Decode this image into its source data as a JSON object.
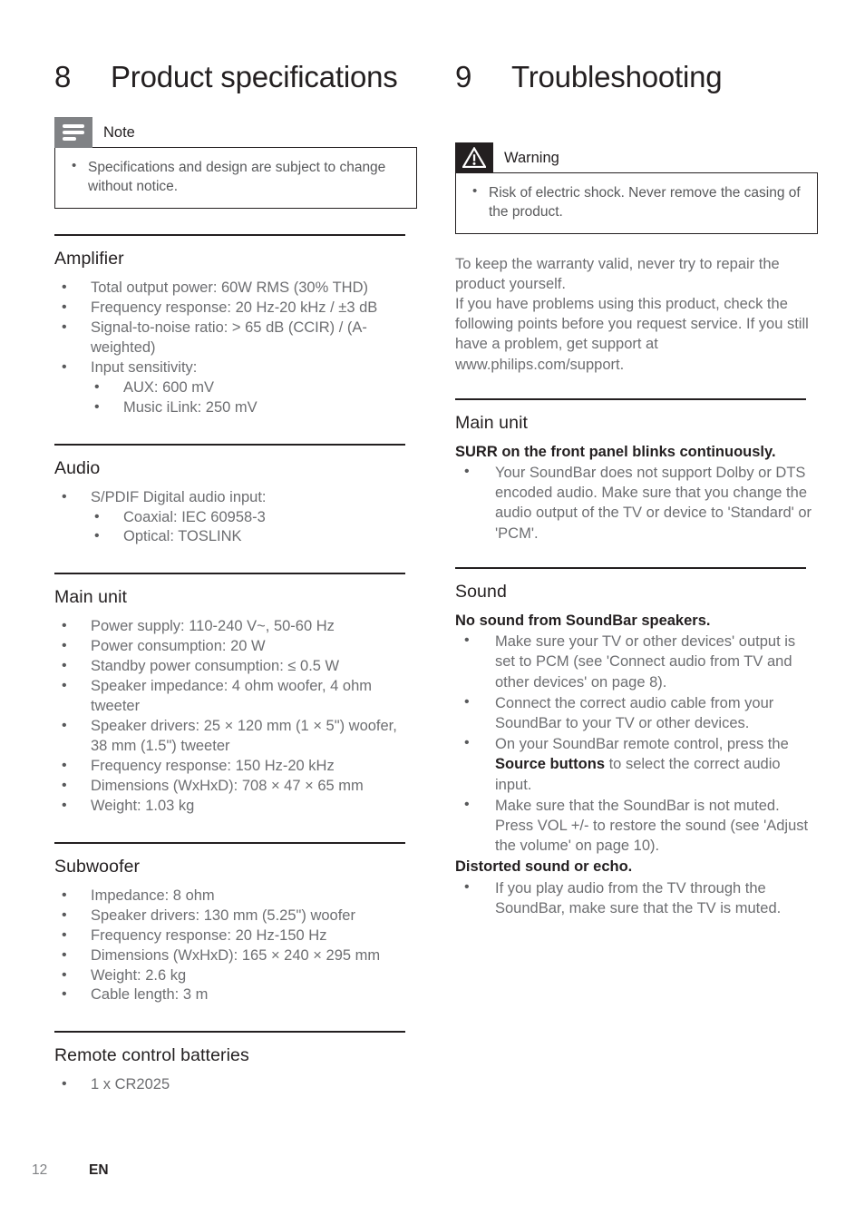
{
  "left_column": {
    "chapter": {
      "number": "8",
      "title": "Product specifications"
    },
    "note_box": {
      "icon": "note-lines-icon",
      "label": "Note",
      "items": [
        "Specifications and design are subject to change without notice."
      ]
    },
    "sections": [
      {
        "title": "Amplifier",
        "items": [
          {
            "text": "Total output power: 60W RMS (30% THD)"
          },
          {
            "text": "Frequency response: 20 Hz-20 kHz / ±3 dB"
          },
          {
            "text": "Signal-to-noise ratio: > 65 dB (CCIR) / (A-weighted)"
          },
          {
            "text": "Input sensitivity:",
            "sub": [
              "AUX: 600 mV",
              "Music iLink: 250 mV"
            ]
          }
        ]
      },
      {
        "title": "Audio",
        "items": [
          {
            "text": "S/PDIF Digital audio input:",
            "sub": [
              "Coaxial: IEC 60958-3",
              "Optical: TOSLINK"
            ]
          }
        ]
      },
      {
        "title": "Main unit",
        "items": [
          {
            "text": "Power supply: 110-240 V~, 50-60 Hz"
          },
          {
            "text": "Power consumption: 20 W"
          },
          {
            "text": "Standby power consumption: ≤ 0.5 W"
          },
          {
            "text": "Speaker impedance: 4 ohm woofer, 4 ohm tweeter"
          },
          {
            "text": "Speaker drivers: 25 × 120 mm (1 × 5\") woofer, 38 mm (1.5\") tweeter"
          },
          {
            "text": "Frequency response: 150 Hz-20 kHz"
          },
          {
            "text": "Dimensions (WxHxD): 708 × 47 × 65 mm"
          },
          {
            "text": "Weight: 1.03 kg"
          }
        ]
      },
      {
        "title": "Subwoofer",
        "items": [
          {
            "text": "Impedance: 8 ohm"
          },
          {
            "text": "Speaker drivers: 130 mm (5.25\") woofer"
          },
          {
            "text": "Frequency response: 20 Hz-150 Hz"
          },
          {
            "text": "Dimensions (WxHxD): 165 × 240 × 295 mm"
          },
          {
            "text": "Weight: 2.6 kg"
          },
          {
            "text": "Cable length: 3 m"
          }
        ]
      },
      {
        "title": "Remote control batteries",
        "items": [
          {
            "text": "1 x CR2025"
          }
        ]
      }
    ]
  },
  "right_column": {
    "chapter": {
      "number": "9",
      "title": "Troubleshooting"
    },
    "warning_box": {
      "icon": "warning-triangle-icon",
      "label": "Warning",
      "items": [
        "Risk of electric shock. Never remove the casing of the product."
      ]
    },
    "intro": {
      "paragraph_1": "To keep the warranty valid, never try to repair the product yourself.",
      "paragraph_2": "If you have problems using this product, check the following points before you request service. If you still have a problem, get support at www.philips.com/support."
    },
    "sections": [
      {
        "title": "Main unit",
        "symptom": "SURR on the front panel blinks continuously.",
        "items": [
          {
            "text": "Your SoundBar does not support Dolby or DTS encoded audio. Make sure that you change the audio output of the TV or device to 'Standard' or 'PCM'."
          }
        ]
      },
      {
        "title": "Sound",
        "symptom": "No sound from SoundBar speakers.",
        "items": [
          {
            "text": "Make sure your TV or other devices' output is set to PCM (see 'Connect audio from TV and other devices' on page 8)."
          },
          {
            "text": "Connect the correct audio cable from your SoundBar to your TV or other devices."
          },
          {
            "pre": "On your SoundBar remote control, press the ",
            "bold": "Source buttons",
            "post": " to select the correct audio input."
          },
          {
            "text": "Make sure that the SoundBar is not muted. Press VOL +/- to restore the sound (see 'Adjust the volume' on page 10)."
          }
        ],
        "symptom_2": "Distorted sound or echo.",
        "items_2": [
          {
            "text": "If you play audio from the TV through the SoundBar, make sure that the TV is muted."
          }
        ]
      }
    ]
  },
  "footer": {
    "page_number": "12",
    "language": "EN"
  },
  "colors": {
    "heading": "#231f20",
    "body": "#6d6e71",
    "note_badge": "#808285",
    "warning_badge": "#231f20"
  }
}
